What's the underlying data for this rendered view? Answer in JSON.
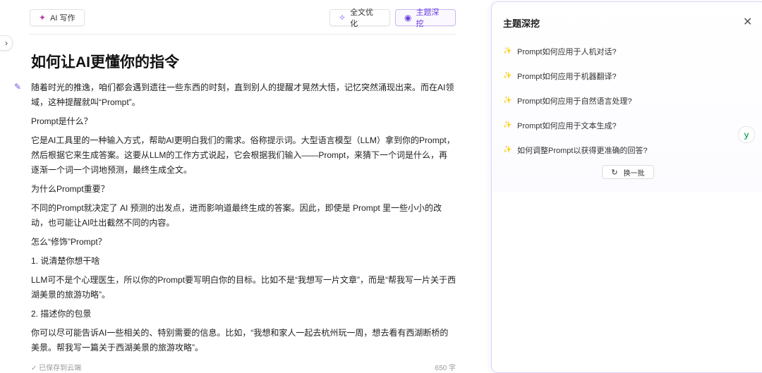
{
  "toolbar": {
    "ai_write_label": "AI 写作",
    "optimize_label": "全文优化",
    "deep_dive_label": "主题深挖"
  },
  "document": {
    "title": "如何让AI更懂你的指令",
    "paragraphs": [
      "随着时光的推逸，咱们都会遇到遗往一些东西的时刻，直到别人的提醒才晃然大悟，记忆突然涌现出来。而在AI领域，这种提醒就叫“Prompt”。",
      "Prompt是什么？",
      "它是AI工具里的一种输入方式，帮助AI更明白我们的需求。俗称提示词。大型语言模型（LLM）拿到你的Prompt，然后根据它来生成答案。这要从LLM的工作方式说起，它会根据我们输入——Prompt，来猜下一个词是什么，再逐渐一个词一个词地预测，最终生成全文。",
      "为什么Prompt重要？",
      "不同的Prompt就决定了 AI 预测的出发点，进而影响道最终生成的答案。因此，即使是 Prompt 里一些小小的改动，也可能让AI吐出截然不同的内容。",
      "怎么“修饰”Prompt？",
      "1. 说清楚你想干啥",
      "LLM可不是个心理医生，所以你的Prompt要写明白你的目标。比如不是“我想写一片文章”，而是“帮我写一片关于西湖美景的旅游功略”。",
      "2. 描述你的包景",
      "你可以尽可能告诉AI一些相关的、特别需要的信息。比如，“我想和家人一起去杭州玩一周，想去看有西湖断桥的美景。帮我写一篇关于西湖美景的旅游攻略”。"
    ]
  },
  "footer": {
    "save_status": "✓ 已保存到云端",
    "word_count": "650 字"
  },
  "panel": {
    "title": "主题深挖",
    "questions": [
      "Prompt如何应用于人机对话?",
      "Prompt如何应用于机器翻译?",
      "Prompt如何应用于自然语言处理?",
      "Prompt如何应用于文本生成?",
      "如何调整Prompt以获得更准确的回答?"
    ],
    "refresh_label": "换一批"
  },
  "colors": {
    "accent": "#6b3fe0",
    "spell_underline": "#e05a5a",
    "spark": "#e8b739"
  }
}
